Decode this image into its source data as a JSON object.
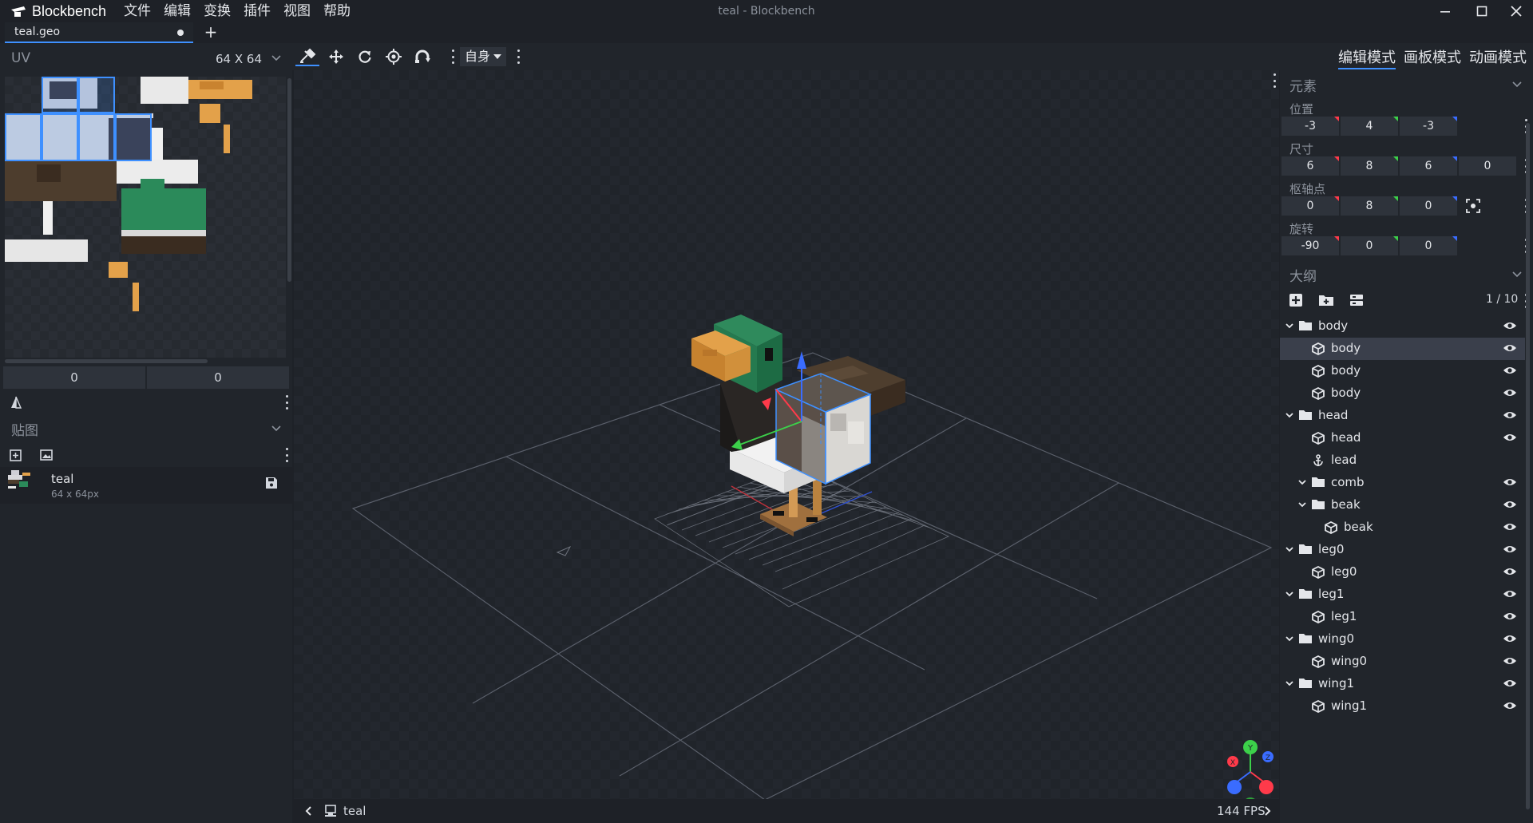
{
  "app": {
    "brand": "Blockbench",
    "window_title": "teal - Blockbench",
    "menu": [
      "文件",
      "编辑",
      "变换",
      "插件",
      "视图",
      "帮助"
    ]
  },
  "tabs": [
    {
      "label": "teal.geo",
      "unsaved": true
    }
  ],
  "uv_panel": {
    "title": "UV",
    "size_label": "64 X 64",
    "offset_x": "0",
    "offset_y": "0"
  },
  "textures_panel": {
    "title": "贴图",
    "items": [
      {
        "name": "teal",
        "dims": "64 x 64px"
      }
    ]
  },
  "toolbar": {
    "space_dropdown": "自身",
    "active_tool": "move"
  },
  "statusbar": {
    "model_name": "teal",
    "fps": "144 FPS"
  },
  "modes": {
    "edit": "编辑模式",
    "paint": "画板模式",
    "animate": "动画模式",
    "active": "edit"
  },
  "element_panel": {
    "title": "元素",
    "position_label": "位置",
    "position": [
      "-3",
      "4",
      "-3"
    ],
    "size_label": "尺寸",
    "size": [
      "6",
      "8",
      "6",
      "0"
    ],
    "pivot_label": "枢轴点",
    "pivot": [
      "0",
      "8",
      "0"
    ],
    "rotation_label": "旋转",
    "rotation": [
      "-90",
      "0",
      "0"
    ]
  },
  "outliner": {
    "title": "大纲",
    "count": "1 / 10",
    "rows": [
      {
        "label": "body",
        "type": "group",
        "depth": 0,
        "expanded": true,
        "eye": true
      },
      {
        "label": "body",
        "type": "cube",
        "depth": 1,
        "selected": true,
        "eye": true
      },
      {
        "label": "body",
        "type": "cube",
        "depth": 1,
        "eye": true
      },
      {
        "label": "body",
        "type": "cube",
        "depth": 1,
        "eye": true
      },
      {
        "label": "head",
        "type": "group",
        "depth": 0,
        "expanded": true,
        "eye": true
      },
      {
        "label": "head",
        "type": "cube",
        "depth": 1,
        "eye": true
      },
      {
        "label": "lead",
        "type": "locator",
        "depth": 1,
        "eye": false
      },
      {
        "label": "comb",
        "type": "group",
        "depth": 1,
        "eye": true
      },
      {
        "label": "beak",
        "type": "group",
        "depth": 1,
        "expanded": true,
        "eye": true
      },
      {
        "label": "beak",
        "type": "cube",
        "depth": 2,
        "eye": true
      },
      {
        "label": "leg0",
        "type": "group",
        "depth": 0,
        "expanded": true,
        "eye": true
      },
      {
        "label": "leg0",
        "type": "cube",
        "depth": 1,
        "eye": true
      },
      {
        "label": "leg1",
        "type": "group",
        "depth": 0,
        "expanded": true,
        "eye": true
      },
      {
        "label": "leg1",
        "type": "cube",
        "depth": 1,
        "eye": true
      },
      {
        "label": "wing0",
        "type": "group",
        "depth": 0,
        "expanded": true,
        "eye": true
      },
      {
        "label": "wing0",
        "type": "cube",
        "depth": 1,
        "eye": true
      },
      {
        "label": "wing1",
        "type": "group",
        "depth": 0,
        "expanded": true,
        "eye": true
      },
      {
        "label": "wing1",
        "type": "cube",
        "depth": 1,
        "eye": true
      }
    ]
  },
  "gizmo_axes": [
    "Y",
    "X",
    "Z"
  ],
  "colors": {
    "accent": "#3e90ff",
    "axis_x": "#ff3a4a",
    "axis_y": "#3cd04a",
    "axis_z": "#3a6cff"
  }
}
